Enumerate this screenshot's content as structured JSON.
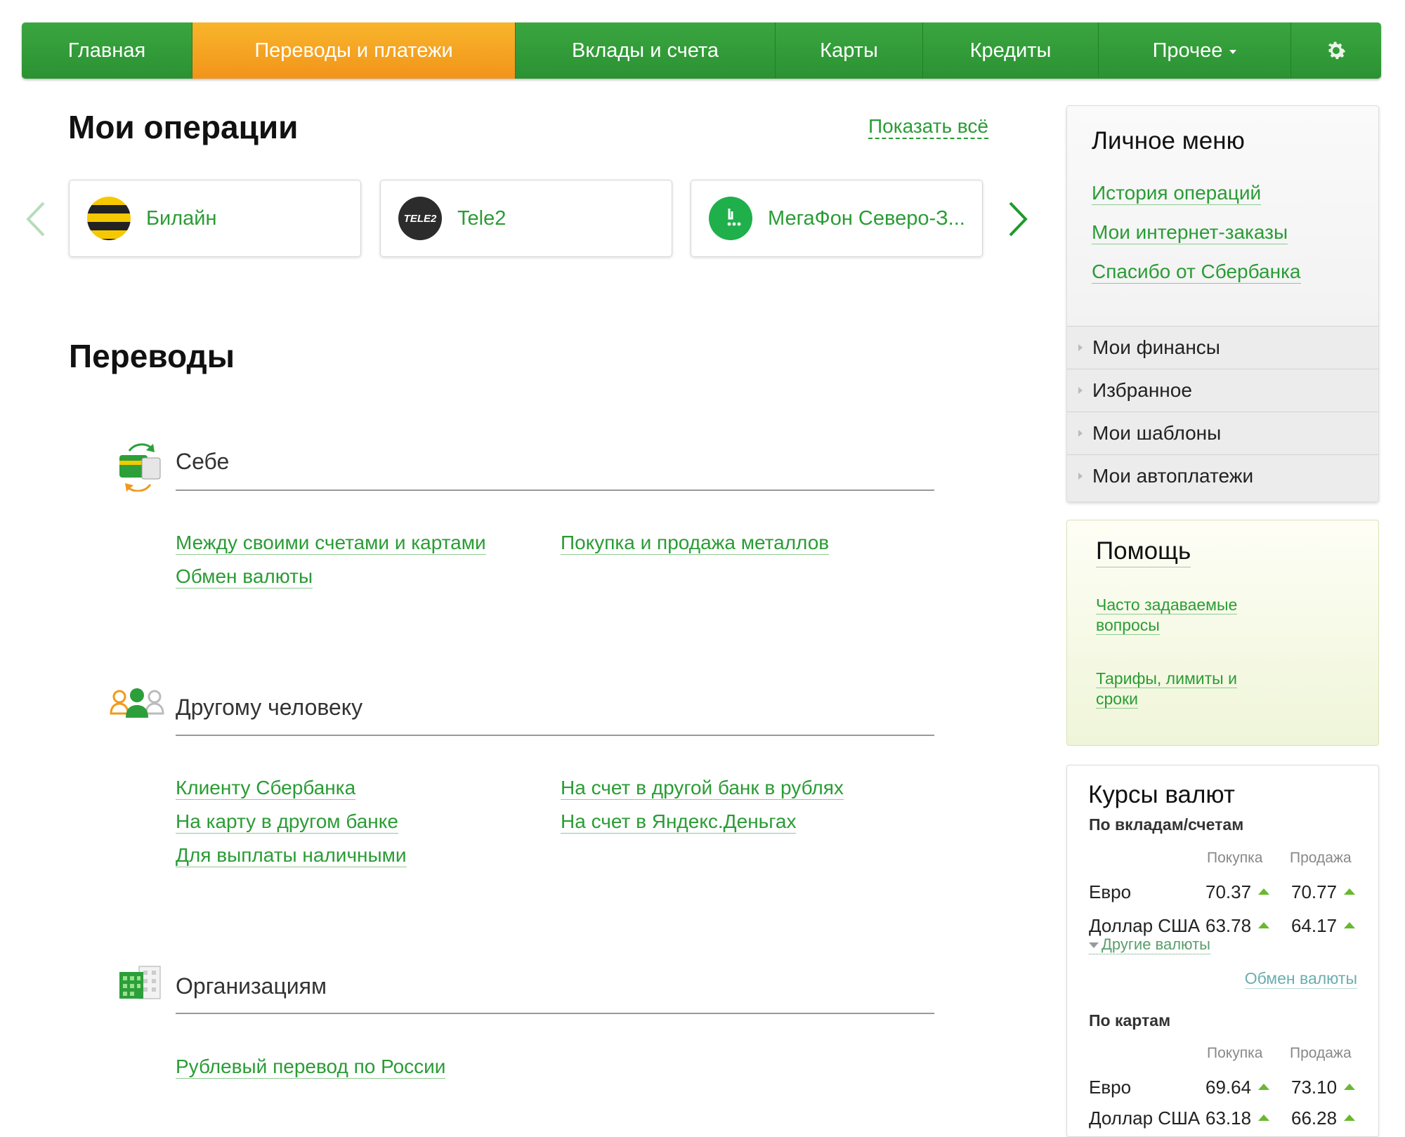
{
  "nav": {
    "items": [
      {
        "label": "Главная"
      },
      {
        "label": "Переводы и платежи"
      },
      {
        "label": "Вклады и счета"
      },
      {
        "label": "Карты"
      },
      {
        "label": "Кредиты"
      },
      {
        "label": "Прочее"
      }
    ],
    "active_color": "#f5a623",
    "brand_color": "#2f9a35"
  },
  "operations": {
    "title": "Мои операции",
    "show_all": "Показать всё",
    "cards": [
      {
        "name": "Билайн",
        "icon": "beeline-logo-icon"
      },
      {
        "name": "Tele2",
        "icon": "tele2-logo-icon",
        "logo_text": "TELE2"
      },
      {
        "name": "МегаФон Северо-З...",
        "icon": "megafon-logo-icon"
      }
    ]
  },
  "transfers": {
    "title": "Переводы",
    "sections": [
      {
        "title": "Себе",
        "icon": "self-transfer-icon",
        "links": [
          "Между своими счетами и картами",
          "Обмен валюты",
          "Покупка и продажа металлов"
        ]
      },
      {
        "title": "Другому человеку",
        "icon": "people-icon",
        "links": [
          "Клиенту Сбербанка",
          "На карту в другом банке",
          "Для выплаты наличными",
          "На счет в другой банк в рублях",
          "На счет в Яндекс.Деньгах"
        ]
      },
      {
        "title": "Организациям",
        "icon": "buildings-icon",
        "links": [
          "Рублевый перевод по России"
        ]
      }
    ]
  },
  "personal_menu": {
    "title": "Личное меню",
    "links": [
      "История операций",
      "Мои интернет-заказы",
      "Спасибо от Сбербанка"
    ],
    "rows": [
      "Мои финансы",
      "Избранное",
      "Мои шаблоны",
      "Мои автоплатежи"
    ]
  },
  "help": {
    "title": "Помощь",
    "links": [
      {
        "line1": "Часто задаваемые",
        "line2": "вопросы"
      },
      {
        "line1": "Тарифы, лимиты и",
        "line2": "сроки"
      }
    ]
  },
  "rates": {
    "title": "Курсы валют",
    "deposits": {
      "subtitle": "По вкладам/счетам",
      "col_buy": "Покупка",
      "col_sell": "Продажа",
      "rows": [
        {
          "currency": "Евро",
          "buy": "70.37",
          "sell": "70.77"
        },
        {
          "currency": "Доллар США",
          "buy": "63.78",
          "sell": "64.17"
        }
      ],
      "other": "Другие валюты",
      "exchange": "Обмен валюты"
    },
    "cards": {
      "subtitle": "По картам",
      "col_buy": "Покупка",
      "col_sell": "Продажа",
      "rows": [
        {
          "currency": "Евро",
          "buy": "69.64",
          "sell": "73.10"
        },
        {
          "currency": "Доллар США",
          "buy": "63.18",
          "sell": "66.28"
        }
      ]
    }
  }
}
